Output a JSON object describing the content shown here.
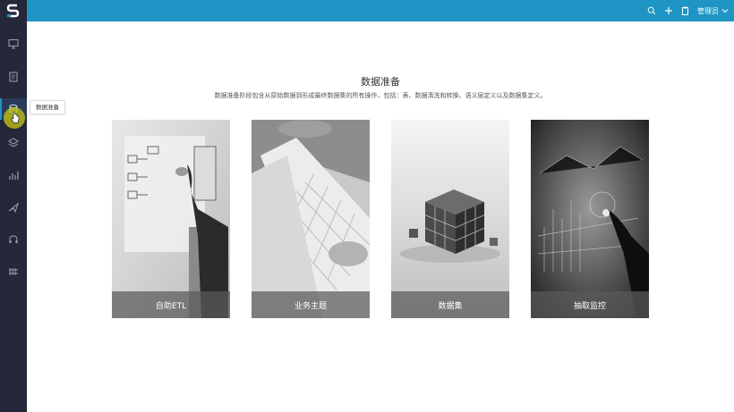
{
  "topbar": {
    "admin_label": "管理员",
    "accent_color": "#1e95c4"
  },
  "sidebar": {
    "tooltip": "数据准备",
    "items": [
      {
        "icon": "monitor-icon"
      },
      {
        "icon": "report-icon"
      },
      {
        "icon": "data-prep-icon",
        "active": true
      },
      {
        "icon": "stack-icon"
      },
      {
        "icon": "bar-chart-icon"
      },
      {
        "icon": "send-icon"
      },
      {
        "icon": "headset-icon"
      },
      {
        "icon": "grid-tools-icon"
      }
    ]
  },
  "main": {
    "title": "数据准备",
    "subtitle": "数据准备阶段包含从原始数据到形成最终数据集的所有操作，包括：表、数据清洗和转换、语义层定义以及数据集定义。",
    "cards": [
      {
        "label": "自助ETL"
      },
      {
        "label": "业务主题"
      },
      {
        "label": "数据集"
      },
      {
        "label": "抽取监控"
      }
    ]
  }
}
